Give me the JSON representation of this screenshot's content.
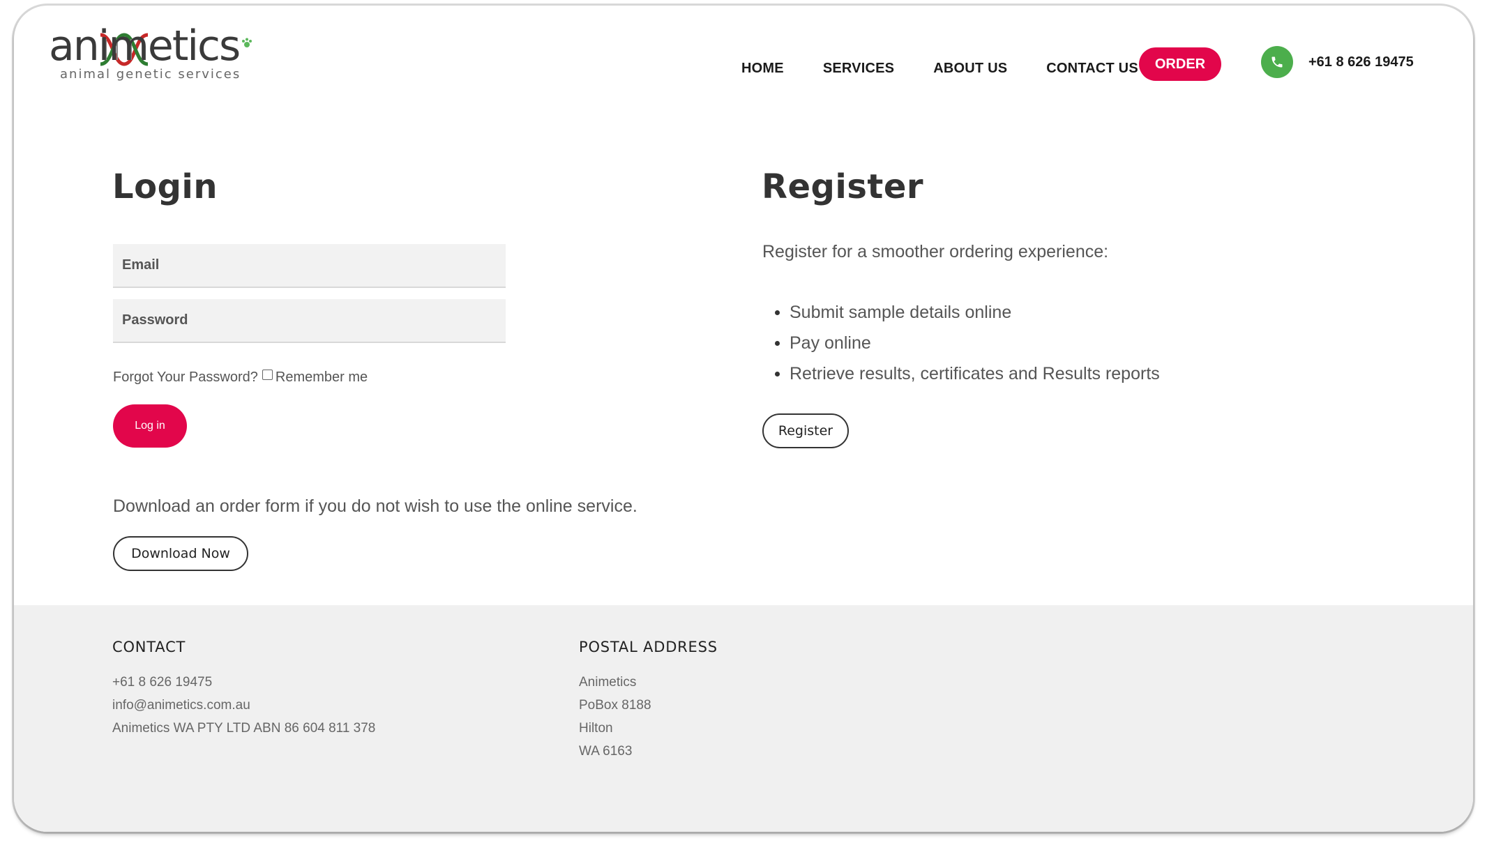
{
  "header": {
    "logo_text": "animetics",
    "logo_tagline": "animal genetic services",
    "nav": [
      "HOME",
      "SERVICES",
      "ABOUT US",
      "CONTACT US"
    ],
    "order_label": "ORDER",
    "phone": "+61 8 626 19475"
  },
  "login": {
    "title": "Login",
    "email_placeholder": "Email",
    "password_placeholder": "Password",
    "forgot_label": "Forgot Your Password?",
    "remember_label": "Remember me",
    "login_button": "Log in",
    "download_text": "Download an order form if you do not wish to use the online service.",
    "download_button": "Download Now"
  },
  "register": {
    "title": "Register",
    "description": "Register for a smoother ordering experience:",
    "benefits": [
      "Submit sample details online",
      "Pay online",
      "Retrieve results, certificates and Results reports"
    ],
    "register_button": "Register"
  },
  "footer": {
    "contact_heading": "CONTACT",
    "contact_lines": [
      "+61 8 626 19475",
      "info@animetics.com.au",
      "Animetics WA PTY LTD ABN 86 604 811 378"
    ],
    "postal_heading": "POSTAL ADDRESS",
    "postal_lines": [
      "Animetics",
      "PoBox 8188",
      "Hilton",
      "WA 6163"
    ]
  },
  "colors": {
    "accent": "#e2064b",
    "phone_green": "#4cae4c",
    "footer_bg": "#f0f0f0"
  },
  "icons": [
    "dna-icon",
    "paw-icon",
    "phone-icon"
  ]
}
